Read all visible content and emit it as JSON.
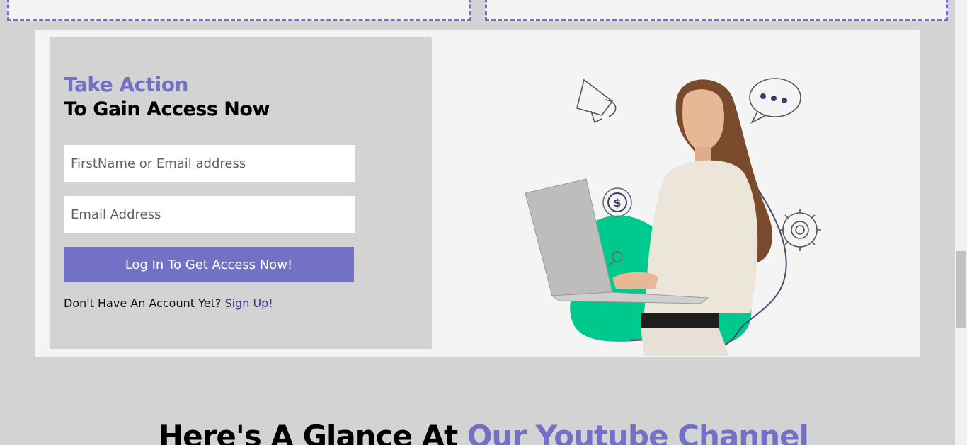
{
  "form": {
    "heading_accent": "Take Action",
    "heading_main": "To Gain Access Now",
    "field1_placeholder": "FirstName or Email address",
    "field2_placeholder": "Email Address",
    "submit_label": "Log In To Get Access Now!",
    "signup_prompt": "Don't Have An Account Yet? ",
    "signup_link": "Sign Up!"
  },
  "illustration": {
    "subject": "woman-with-laptop",
    "icons": [
      "megaphone-icon",
      "chat-bubble-icon",
      "dollar-coin-icon",
      "gear-icon",
      "magnifier-icon"
    ],
    "blob_color": "#00c98d",
    "accent_color": "#7271c6"
  },
  "section": {
    "heading_prefix": "Here's A Glance At ",
    "heading_accent": "Our Youtube Channel"
  },
  "colors": {
    "accent": "#7271c6",
    "page_bg": "#d3d3d3",
    "panel_bg": "#f4f4f4"
  }
}
